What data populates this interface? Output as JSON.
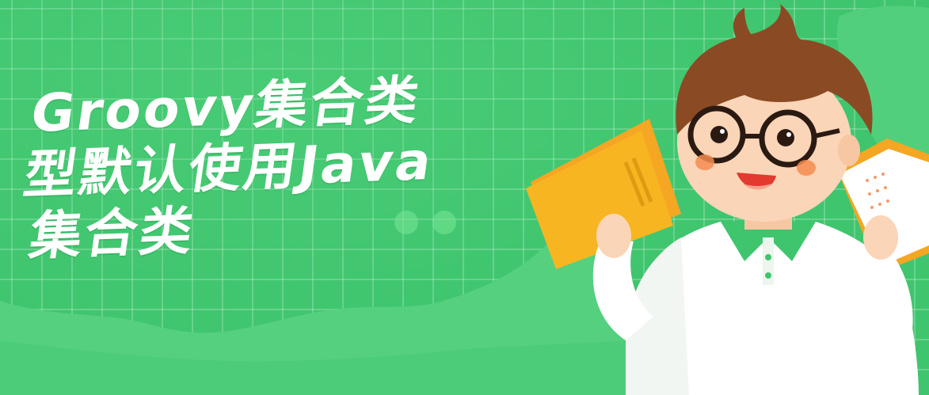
{
  "title": {
    "line1": "Groovy集合类",
    "line2": "型默认使用Java",
    "line3": "集合类"
  },
  "colors": {
    "background": "#3fc56e",
    "grid": "#7ddb9c",
    "hill": "#5ad683",
    "card": "#f7b521",
    "shirt": "#ffffff",
    "collar": "#3fc56e",
    "hair": "#8a4a23"
  },
  "illustration": {
    "subject": "cartoon boy with glasses holding cards",
    "icons": [
      "boy-character-illustration",
      "yellow-card-icon",
      "white-card-icon"
    ]
  }
}
